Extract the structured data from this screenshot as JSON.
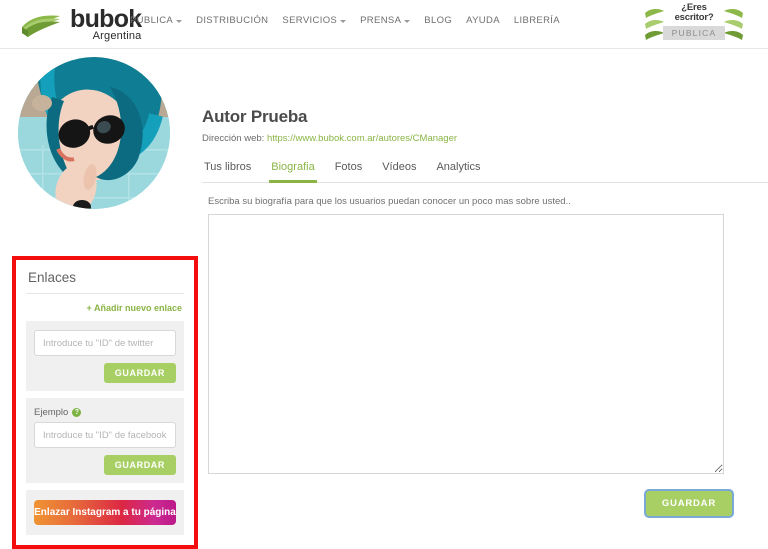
{
  "header": {
    "brand": {
      "name": "bubok",
      "sub": "Argentina",
      "logo_icon": "book-stack-icon"
    },
    "nav": [
      {
        "label": "PUBLICA",
        "has_caret": true
      },
      {
        "label": "DISTRIBUCIÓN",
        "has_caret": false
      },
      {
        "label": "SERVICIOS",
        "has_caret": true
      },
      {
        "label": "PRENSA",
        "has_caret": true
      },
      {
        "label": "BLOG",
        "has_caret": false
      },
      {
        "label": "AYUDA",
        "has_caret": false
      },
      {
        "label": "LIBRERÍA",
        "has_caret": false
      }
    ],
    "writer_badge": {
      "line1": "¿Eres",
      "line2": "escritor?",
      "button": "PUBLICA",
      "decor_icon": "leaf-book-icon"
    }
  },
  "profile": {
    "avatar_alt": "author-avatar",
    "name": "Autor Prueba",
    "web_label": "Dirección web:",
    "web_url": "https://www.bubok.com.ar/autores/CManager"
  },
  "tabs": [
    {
      "label": "Tus libros",
      "active": false
    },
    {
      "label": "Biografia",
      "active": true
    },
    {
      "label": "Fotos",
      "active": false
    },
    {
      "label": "Vídeos",
      "active": false
    },
    {
      "label": "Analytics",
      "active": false
    }
  ],
  "biography": {
    "hint": "Escriba su biografía para que los usuarios puedan conocer un poco mas sobre usted..",
    "value": "",
    "placeholder": "",
    "save_label": "GUARDAR"
  },
  "enlaces": {
    "title": "Enlaces",
    "add_link_label": "+ Añadir nuevo enlace",
    "rows": [
      {
        "label": "",
        "has_help_icon": false,
        "placeholder": "Introduce tu \"ID\" de twitter",
        "value": "",
        "save_label": "GUARDAR"
      },
      {
        "label": "Ejemplo",
        "has_help_icon": true,
        "help_icon_glyph": "?",
        "placeholder": "Introduce tu \"ID\" de facebook",
        "value": "",
        "save_label": "GUARDAR"
      }
    ],
    "instagram_button": "Enlazar Instagram a tu página"
  },
  "colors": {
    "brand_green": "#8ab545",
    "button_green": "#a8cf64",
    "annotation_red": "#f40d0d",
    "text_gray": "#555555",
    "panel_gray": "#f0f0f0",
    "focus_blue": "#7aa9d6"
  }
}
